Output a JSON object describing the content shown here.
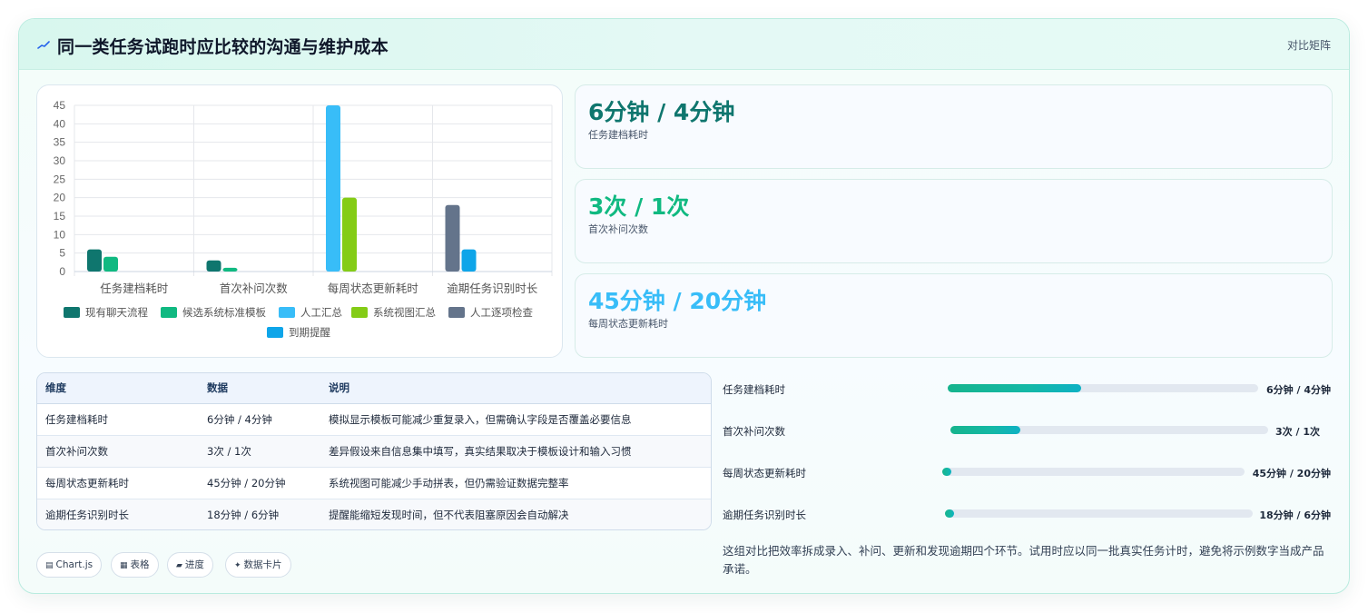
{
  "header": {
    "title": "同一类任务试跑时应比较的沟通与维护成本",
    "tag": "对比矩阵"
  },
  "chart_data": {
    "type": "bar",
    "categories": [
      "任务建档耗时",
      "首次补问次数",
      "每周状态更新耗时",
      "逾期任务识别时长"
    ],
    "ylim": [
      0,
      45
    ],
    "yticks": [
      0,
      5,
      10,
      15,
      20,
      25,
      30,
      35,
      40,
      45
    ],
    "series": [
      {
        "name": "现有聊天流程",
        "color": "#0f766e",
        "values": [
          6,
          3,
          null,
          null
        ]
      },
      {
        "name": "候选系统标准模板",
        "color": "#10b981",
        "values": [
          4,
          1,
          null,
          null
        ]
      },
      {
        "name": "人工汇总",
        "color": "#38bdf8",
        "values": [
          null,
          null,
          45,
          null
        ]
      },
      {
        "name": "系统视图汇总",
        "color": "#84cc16",
        "values": [
          null,
          null,
          20,
          null
        ]
      },
      {
        "name": "人工逐项检查",
        "color": "#64748b",
        "values": [
          null,
          null,
          null,
          18
        ]
      },
      {
        "name": "到期提醒",
        "color": "#0ea5e9",
        "values": [
          null,
          null,
          null,
          6
        ]
      }
    ],
    "grid": true,
    "legend": "bottom"
  },
  "metrics": [
    {
      "value": "6分钟 / 4分钟",
      "label": "任务建档耗时",
      "color": "#0f766e"
    },
    {
      "value": "3次 / 1次",
      "label": "首次补问次数",
      "color": "#10b981"
    },
    {
      "value": "45分钟 / 20分钟",
      "label": "每周状态更新耗时",
      "color": "#38bdf8"
    }
  ],
  "table": {
    "headers": [
      "维度",
      "数据",
      "说明"
    ],
    "rows": [
      [
        "任务建档耗时",
        "6分钟 / 4分钟",
        "模拟显示模板可能减少重复录入，但需确认字段是否覆盖必要信息"
      ],
      [
        "首次补问次数",
        "3次 / 1次",
        "差异假设来自信息集中填写，真实结果取决于模板设计和输入习惯"
      ],
      [
        "每周状态更新耗时",
        "45分钟 / 20分钟",
        "系统视图可能减少手动拼表，但仍需验证数据完整率"
      ],
      [
        "逾期任务识别时长",
        "18分钟 / 6分钟",
        "提醒能缩短发现时间，但不代表阻塞原因会自动解决"
      ]
    ]
  },
  "chips": [
    {
      "icon": "chart-icon",
      "glyph": "▤",
      "label": "Chart.js"
    },
    {
      "icon": "table-icon",
      "glyph": "▦",
      "label": "表格"
    },
    {
      "icon": "progress-icon",
      "glyph": "▰",
      "label": "进度"
    },
    {
      "icon": "sparkle-icon",
      "glyph": "✦",
      "label": "数据卡片"
    }
  ],
  "progress": [
    {
      "label": "任务建档耗时",
      "value": "6分钟 / 4分钟",
      "fill": 0.43
    },
    {
      "label": "首次补问次数",
      "value": "3次 / 1次",
      "fill": 0.22
    },
    {
      "label": "每周状态更新耗时",
      "value": "45分钟 / 20分钟",
      "fill": 0.03
    },
    {
      "label": "逾期任务识别时长",
      "value": "18分钟 / 6分钟",
      "fill": 0.03
    }
  ],
  "summary": "这组对比把效率拆成录入、补问、更新和发现逾期四个环节。试用时应以同一批真实任务计时，避免将示例数字当成产品承诺。"
}
